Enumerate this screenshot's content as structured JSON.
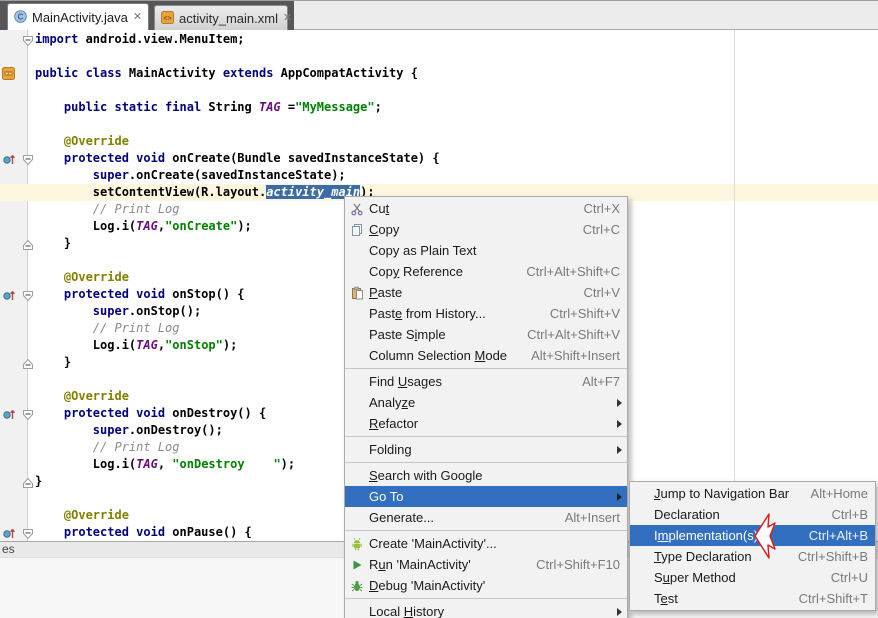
{
  "window": {
    "bottom_left_label": "es"
  },
  "tabs": [
    {
      "label": "MainActivity.java",
      "icon": "java-class",
      "close_glyph": "✕",
      "active": true
    },
    {
      "label": "activity_main.xml",
      "icon": "xml-file",
      "close_glyph": "✕",
      "active": false
    }
  ],
  "editor": {
    "current_line": 10,
    "colors": {
      "keyword": "#000080",
      "string": "#008000",
      "comment": "#8C8C8C",
      "annotation": "#808000",
      "field": "#660E7A",
      "selection_bg": "#3C6CA8",
      "current_line_bg": "#FCF6DE",
      "margin_guide": "#DCDCDC"
    },
    "lines": [
      {
        "tokens": [
          [
            "k",
            "import"
          ],
          [
            "p",
            " android.view.MenuItem;"
          ]
        ]
      },
      {
        "tokens": []
      },
      {
        "tokens": [
          [
            "k",
            "public class"
          ],
          [
            "p",
            " MainActivity "
          ],
          [
            "k",
            "extends"
          ],
          [
            "p",
            " AppCompatActivity {"
          ]
        ]
      },
      {
        "tokens": []
      },
      {
        "tokens": [
          [
            "p",
            "    "
          ],
          [
            "k",
            "public static final"
          ],
          [
            "p",
            " String "
          ],
          [
            "f",
            "TAG"
          ],
          [
            "p",
            " ="
          ],
          [
            "s",
            "\"MyMessage\""
          ],
          [
            "p",
            ";"
          ]
        ]
      },
      {
        "tokens": []
      },
      {
        "tokens": [
          [
            "p",
            "    "
          ],
          [
            "a",
            "@Override"
          ]
        ]
      },
      {
        "tokens": [
          [
            "p",
            "    "
          ],
          [
            "k",
            "protected void"
          ],
          [
            "p",
            " onCreate(Bundle savedInstanceState) {"
          ]
        ]
      },
      {
        "tokens": [
          [
            "p",
            "        "
          ],
          [
            "k",
            "super"
          ],
          [
            "p",
            ".onCreate(savedInstanceState);"
          ]
        ]
      },
      {
        "tokens": [
          [
            "p",
            "        setContentView(R.layout."
          ],
          [
            "x",
            "activity_main"
          ],
          [
            "p",
            ");"
          ]
        ]
      },
      {
        "tokens": [
          [
            "p",
            "        "
          ],
          [
            "c",
            "// Print Log"
          ]
        ]
      },
      {
        "tokens": [
          [
            "p",
            "        Log.i("
          ],
          [
            "f",
            "TAG"
          ],
          [
            "p",
            ","
          ],
          [
            "s",
            "\"onCreate\""
          ],
          [
            "p",
            ");"
          ]
        ]
      },
      {
        "tokens": [
          [
            "p",
            "    }"
          ]
        ]
      },
      {
        "tokens": []
      },
      {
        "tokens": [
          [
            "p",
            "    "
          ],
          [
            "a",
            "@Override"
          ]
        ]
      },
      {
        "tokens": [
          [
            "p",
            "    "
          ],
          [
            "k",
            "protected void"
          ],
          [
            "p",
            " onStop() {"
          ]
        ]
      },
      {
        "tokens": [
          [
            "p",
            "        "
          ],
          [
            "k",
            "super"
          ],
          [
            "p",
            ".onStop();"
          ]
        ]
      },
      {
        "tokens": [
          [
            "p",
            "        "
          ],
          [
            "c",
            "// Print Log"
          ]
        ]
      },
      {
        "tokens": [
          [
            "p",
            "        Log.i("
          ],
          [
            "f",
            "TAG"
          ],
          [
            "p",
            ","
          ],
          [
            "s",
            "\"onStop\""
          ],
          [
            "p",
            ");"
          ]
        ]
      },
      {
        "tokens": [
          [
            "p",
            "    }"
          ]
        ]
      },
      {
        "tokens": []
      },
      {
        "tokens": [
          [
            "p",
            "    "
          ],
          [
            "a",
            "@Override"
          ]
        ]
      },
      {
        "tokens": [
          [
            "p",
            "    "
          ],
          [
            "k",
            "protected void"
          ],
          [
            "p",
            " onDestroy() {"
          ]
        ]
      },
      {
        "tokens": [
          [
            "p",
            "        "
          ],
          [
            "k",
            "super"
          ],
          [
            "p",
            ".onDestroy();"
          ]
        ]
      },
      {
        "tokens": [
          [
            "p",
            "        "
          ],
          [
            "c",
            "// Print Log"
          ]
        ]
      },
      {
        "tokens": [
          [
            "p",
            "        Log.i("
          ],
          [
            "f",
            "TAG"
          ],
          [
            "p",
            ", "
          ],
          [
            "s",
            "\"onDestroy    \""
          ],
          [
            "p",
            ");"
          ]
        ]
      },
      {
        "tokens": [
          [
            "p",
            "}"
          ]
        ]
      },
      {
        "tokens": []
      },
      {
        "tokens": [
          [
            "p",
            "    "
          ],
          [
            "a",
            "@Override"
          ]
        ]
      },
      {
        "tokens": [
          [
            "p",
            "    "
          ],
          [
            "k",
            "protected void"
          ],
          [
            "p",
            " onPause() {"
          ]
        ]
      }
    ]
  },
  "gutter": {
    "override_marker_lines": [
      8,
      16,
      23,
      30
    ],
    "class_icon_line": 3,
    "fold_markers": [
      {
        "line": 1,
        "dir": "down"
      },
      {
        "line": 8,
        "dir": "down"
      },
      {
        "line": 13,
        "dir": "up"
      },
      {
        "line": 16,
        "dir": "down"
      },
      {
        "line": 20,
        "dir": "up"
      },
      {
        "line": 23,
        "dir": "down"
      },
      {
        "line": 27,
        "dir": "up"
      },
      {
        "line": 30,
        "dir": "down"
      }
    ]
  },
  "context_menu": {
    "accent": "#336FC0",
    "items": [
      {
        "label": "Cut",
        "mnemonic": 2,
        "shortcut": "Ctrl+X",
        "icon": "cut"
      },
      {
        "label": "Copy",
        "mnemonic": 0,
        "shortcut": "Ctrl+C",
        "icon": "copy"
      },
      {
        "label": "Copy as Plain Text",
        "mnemonic": -1,
        "shortcut": ""
      },
      {
        "label": "Copy Reference",
        "mnemonic": 3,
        "shortcut": "Ctrl+Alt+Shift+C"
      },
      {
        "label": "Paste",
        "mnemonic": 0,
        "shortcut": "Ctrl+V",
        "icon": "paste"
      },
      {
        "label": "Paste from History...",
        "mnemonic": 4,
        "shortcut": "Ctrl+Shift+V"
      },
      {
        "label": "Paste Simple",
        "mnemonic": 7,
        "shortcut": "Ctrl+Alt+Shift+V"
      },
      {
        "label": "Column Selection Mode",
        "mnemonic": 17,
        "shortcut": "Alt+Shift+Insert"
      },
      {
        "separator": true
      },
      {
        "label": "Find Usages",
        "mnemonic": 5,
        "shortcut": "Alt+F7"
      },
      {
        "label": "Analyze",
        "mnemonic": 5,
        "submenu": true
      },
      {
        "label": "Refactor",
        "mnemonic": 0,
        "submenu": true
      },
      {
        "separator": true
      },
      {
        "label": "Folding",
        "mnemonic": -1,
        "submenu": true
      },
      {
        "separator": true
      },
      {
        "label": "Search with Google",
        "mnemonic": 0
      },
      {
        "label": "Go To",
        "mnemonic": -1,
        "submenu": true,
        "selected": true
      },
      {
        "label": "Generate...",
        "mnemonic": -1,
        "shortcut": "Alt+Insert"
      },
      {
        "separator": true
      },
      {
        "label": "Create 'MainActivity'...",
        "mnemonic": -1,
        "icon": "android"
      },
      {
        "label": "Run 'MainActivity'",
        "mnemonic": 1,
        "shortcut": "Ctrl+Shift+F10",
        "icon": "run"
      },
      {
        "label": "Debug 'MainActivity'",
        "mnemonic": 0,
        "icon": "debug"
      },
      {
        "separator": true
      },
      {
        "label": "Local History",
        "mnemonic": 6,
        "submenu": true
      }
    ]
  },
  "go_to_submenu": {
    "items": [
      {
        "label": "Jump to Navigation Bar",
        "mnemonic": 0,
        "shortcut": "Alt+Home"
      },
      {
        "label": "Declaration",
        "mnemonic": -1,
        "shortcut": "Ctrl+B"
      },
      {
        "label": "Implementation(s)",
        "mnemonic": 1,
        "shortcut": "Ctrl+Alt+B",
        "selected": true
      },
      {
        "label": "Type Declaration",
        "mnemonic": 0,
        "shortcut": "Ctrl+Shift+B"
      },
      {
        "label": "Super Method",
        "mnemonic": 1,
        "shortcut": "Ctrl+U"
      },
      {
        "label": "Test",
        "mnemonic": 1,
        "shortcut": "Ctrl+Shift+T"
      }
    ]
  },
  "annotation_arrow": {
    "points_at": "Implementation(s)",
    "outline": "#E02020",
    "fill": "#FFFFFF"
  }
}
